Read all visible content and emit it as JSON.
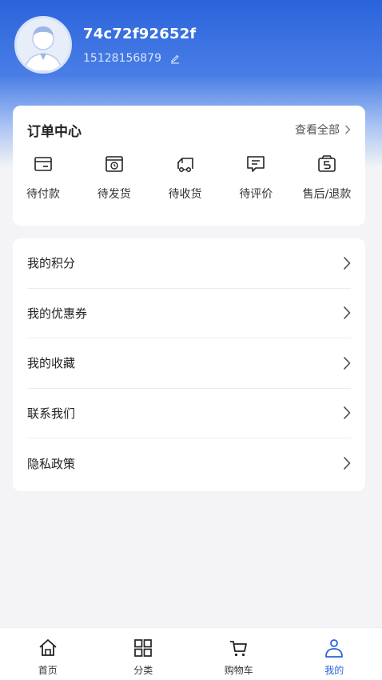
{
  "user": {
    "name": "74c72f92652f",
    "phone": "15128156879"
  },
  "orders": {
    "title": "订单中心",
    "view_all": "查看全部",
    "items": [
      {
        "label": "待付款",
        "icon": "wallet-icon"
      },
      {
        "label": "待发货",
        "icon": "package-icon"
      },
      {
        "label": "待收货",
        "icon": "truck-icon"
      },
      {
        "label": "待评价",
        "icon": "comment-icon"
      },
      {
        "label": "售后/退款",
        "icon": "refund-icon"
      }
    ]
  },
  "menu": [
    {
      "label": "我的积分"
    },
    {
      "label": "我的优惠券"
    },
    {
      "label": "我的收藏"
    },
    {
      "label": "联系我们"
    },
    {
      "label": "隐私政策"
    }
  ],
  "tabs": [
    {
      "label": "首页",
      "icon": "home-icon"
    },
    {
      "label": "分类",
      "icon": "grid-icon"
    },
    {
      "label": "购物车",
      "icon": "cart-icon"
    },
    {
      "label": "我的",
      "icon": "user-icon"
    }
  ],
  "colors": {
    "accent": "#2a63db",
    "header_top": "#2a63db",
    "background": "#f4f4f6"
  }
}
